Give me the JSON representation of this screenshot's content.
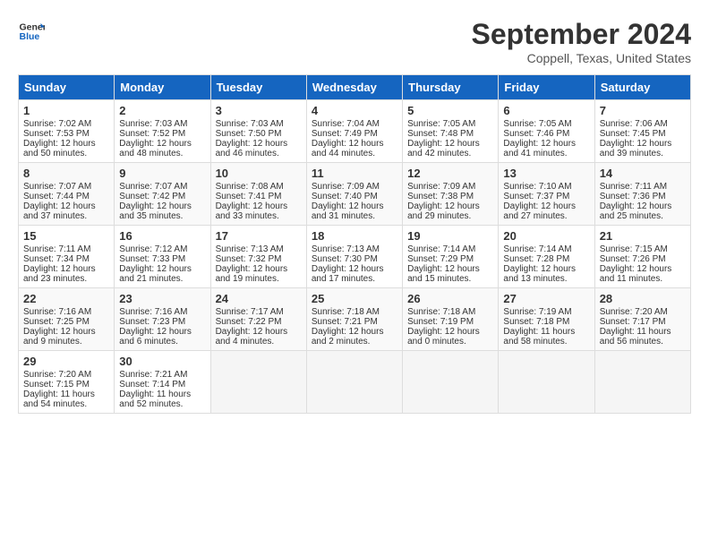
{
  "header": {
    "logo_line1": "General",
    "logo_line2": "Blue",
    "title": "September 2024",
    "subtitle": "Coppell, Texas, United States"
  },
  "weekdays": [
    "Sunday",
    "Monday",
    "Tuesday",
    "Wednesday",
    "Thursday",
    "Friday",
    "Saturday"
  ],
  "weeks": [
    [
      {
        "day": "1",
        "sunrise": "7:02 AM",
        "sunset": "7:53 PM",
        "daylight": "Daylight: 12 hours and 50 minutes."
      },
      {
        "day": "2",
        "sunrise": "7:03 AM",
        "sunset": "7:52 PM",
        "daylight": "Daylight: 12 hours and 48 minutes."
      },
      {
        "day": "3",
        "sunrise": "7:03 AM",
        "sunset": "7:50 PM",
        "daylight": "Daylight: 12 hours and 46 minutes."
      },
      {
        "day": "4",
        "sunrise": "7:04 AM",
        "sunset": "7:49 PM",
        "daylight": "Daylight: 12 hours and 44 minutes."
      },
      {
        "day": "5",
        "sunrise": "7:05 AM",
        "sunset": "7:48 PM",
        "daylight": "Daylight: 12 hours and 42 minutes."
      },
      {
        "day": "6",
        "sunrise": "7:05 AM",
        "sunset": "7:46 PM",
        "daylight": "Daylight: 12 hours and 41 minutes."
      },
      {
        "day": "7",
        "sunrise": "7:06 AM",
        "sunset": "7:45 PM",
        "daylight": "Daylight: 12 hours and 39 minutes."
      }
    ],
    [
      {
        "day": "8",
        "sunrise": "7:07 AM",
        "sunset": "7:44 PM",
        "daylight": "Daylight: 12 hours and 37 minutes."
      },
      {
        "day": "9",
        "sunrise": "7:07 AM",
        "sunset": "7:42 PM",
        "daylight": "Daylight: 12 hours and 35 minutes."
      },
      {
        "day": "10",
        "sunrise": "7:08 AM",
        "sunset": "7:41 PM",
        "daylight": "Daylight: 12 hours and 33 minutes."
      },
      {
        "day": "11",
        "sunrise": "7:09 AM",
        "sunset": "7:40 PM",
        "daylight": "Daylight: 12 hours and 31 minutes."
      },
      {
        "day": "12",
        "sunrise": "7:09 AM",
        "sunset": "7:38 PM",
        "daylight": "Daylight: 12 hours and 29 minutes."
      },
      {
        "day": "13",
        "sunrise": "7:10 AM",
        "sunset": "7:37 PM",
        "daylight": "Daylight: 12 hours and 27 minutes."
      },
      {
        "day": "14",
        "sunrise": "7:11 AM",
        "sunset": "7:36 PM",
        "daylight": "Daylight: 12 hours and 25 minutes."
      }
    ],
    [
      {
        "day": "15",
        "sunrise": "7:11 AM",
        "sunset": "7:34 PM",
        "daylight": "Daylight: 12 hours and 23 minutes."
      },
      {
        "day": "16",
        "sunrise": "7:12 AM",
        "sunset": "7:33 PM",
        "daylight": "Daylight: 12 hours and 21 minutes."
      },
      {
        "day": "17",
        "sunrise": "7:13 AM",
        "sunset": "7:32 PM",
        "daylight": "Daylight: 12 hours and 19 minutes."
      },
      {
        "day": "18",
        "sunrise": "7:13 AM",
        "sunset": "7:30 PM",
        "daylight": "Daylight: 12 hours and 17 minutes."
      },
      {
        "day": "19",
        "sunrise": "7:14 AM",
        "sunset": "7:29 PM",
        "daylight": "Daylight: 12 hours and 15 minutes."
      },
      {
        "day": "20",
        "sunrise": "7:14 AM",
        "sunset": "7:28 PM",
        "daylight": "Daylight: 12 hours and 13 minutes."
      },
      {
        "day": "21",
        "sunrise": "7:15 AM",
        "sunset": "7:26 PM",
        "daylight": "Daylight: 12 hours and 11 minutes."
      }
    ],
    [
      {
        "day": "22",
        "sunrise": "7:16 AM",
        "sunset": "7:25 PM",
        "daylight": "Daylight: 12 hours and 9 minutes."
      },
      {
        "day": "23",
        "sunrise": "7:16 AM",
        "sunset": "7:23 PM",
        "daylight": "Daylight: 12 hours and 6 minutes."
      },
      {
        "day": "24",
        "sunrise": "7:17 AM",
        "sunset": "7:22 PM",
        "daylight": "Daylight: 12 hours and 4 minutes."
      },
      {
        "day": "25",
        "sunrise": "7:18 AM",
        "sunset": "7:21 PM",
        "daylight": "Daylight: 12 hours and 2 minutes."
      },
      {
        "day": "26",
        "sunrise": "7:18 AM",
        "sunset": "7:19 PM",
        "daylight": "Daylight: 12 hours and 0 minutes."
      },
      {
        "day": "27",
        "sunrise": "7:19 AM",
        "sunset": "7:18 PM",
        "daylight": "Daylight: 11 hours and 58 minutes."
      },
      {
        "day": "28",
        "sunrise": "7:20 AM",
        "sunset": "7:17 PM",
        "daylight": "Daylight: 11 hours and 56 minutes."
      }
    ],
    [
      {
        "day": "29",
        "sunrise": "7:20 AM",
        "sunset": "7:15 PM",
        "daylight": "Daylight: 11 hours and 54 minutes."
      },
      {
        "day": "30",
        "sunrise": "7:21 AM",
        "sunset": "7:14 PM",
        "daylight": "Daylight: 11 hours and 52 minutes."
      },
      null,
      null,
      null,
      null,
      null
    ]
  ]
}
